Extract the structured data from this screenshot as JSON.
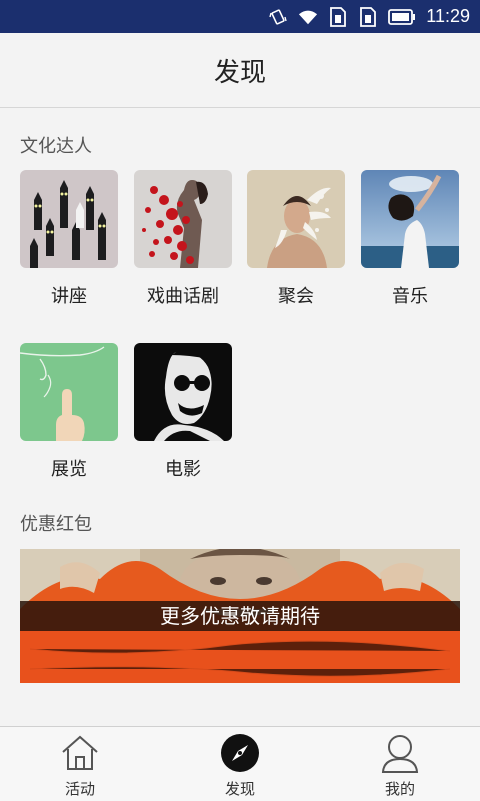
{
  "status_bar": {
    "time": "11:29",
    "icons": [
      "vibrate-icon",
      "wifi-icon",
      "sim1-icon",
      "sim2-icon",
      "battery-icon"
    ]
  },
  "header": {
    "title": "发现"
  },
  "culture": {
    "section_title": "文化达人",
    "items": [
      {
        "label": "讲座",
        "icon": "cats-illustration"
      },
      {
        "label": "戏曲话剧",
        "icon": "woman-petals-photo"
      },
      {
        "label": "聚会",
        "icon": "man-splash-photo"
      },
      {
        "label": "音乐",
        "icon": "woman-sea-photo"
      },
      {
        "label": "展览",
        "icon": "hand-green-illustration"
      },
      {
        "label": "电影",
        "icon": "man-sunglasses-poster"
      }
    ]
  },
  "coupon": {
    "section_title": "优惠红包",
    "banner_caption": "更多优惠敬请期待"
  },
  "tabbar": {
    "tabs": [
      {
        "label": "活动",
        "icon": "home-icon",
        "active": false
      },
      {
        "label": "发现",
        "icon": "compass-icon",
        "active": true
      },
      {
        "label": "我的",
        "icon": "user-icon",
        "active": false
      }
    ]
  },
  "colors": {
    "status_bar": "#1b2f6e",
    "banner_orange": "#e8511c",
    "background": "#f3f3f3"
  }
}
